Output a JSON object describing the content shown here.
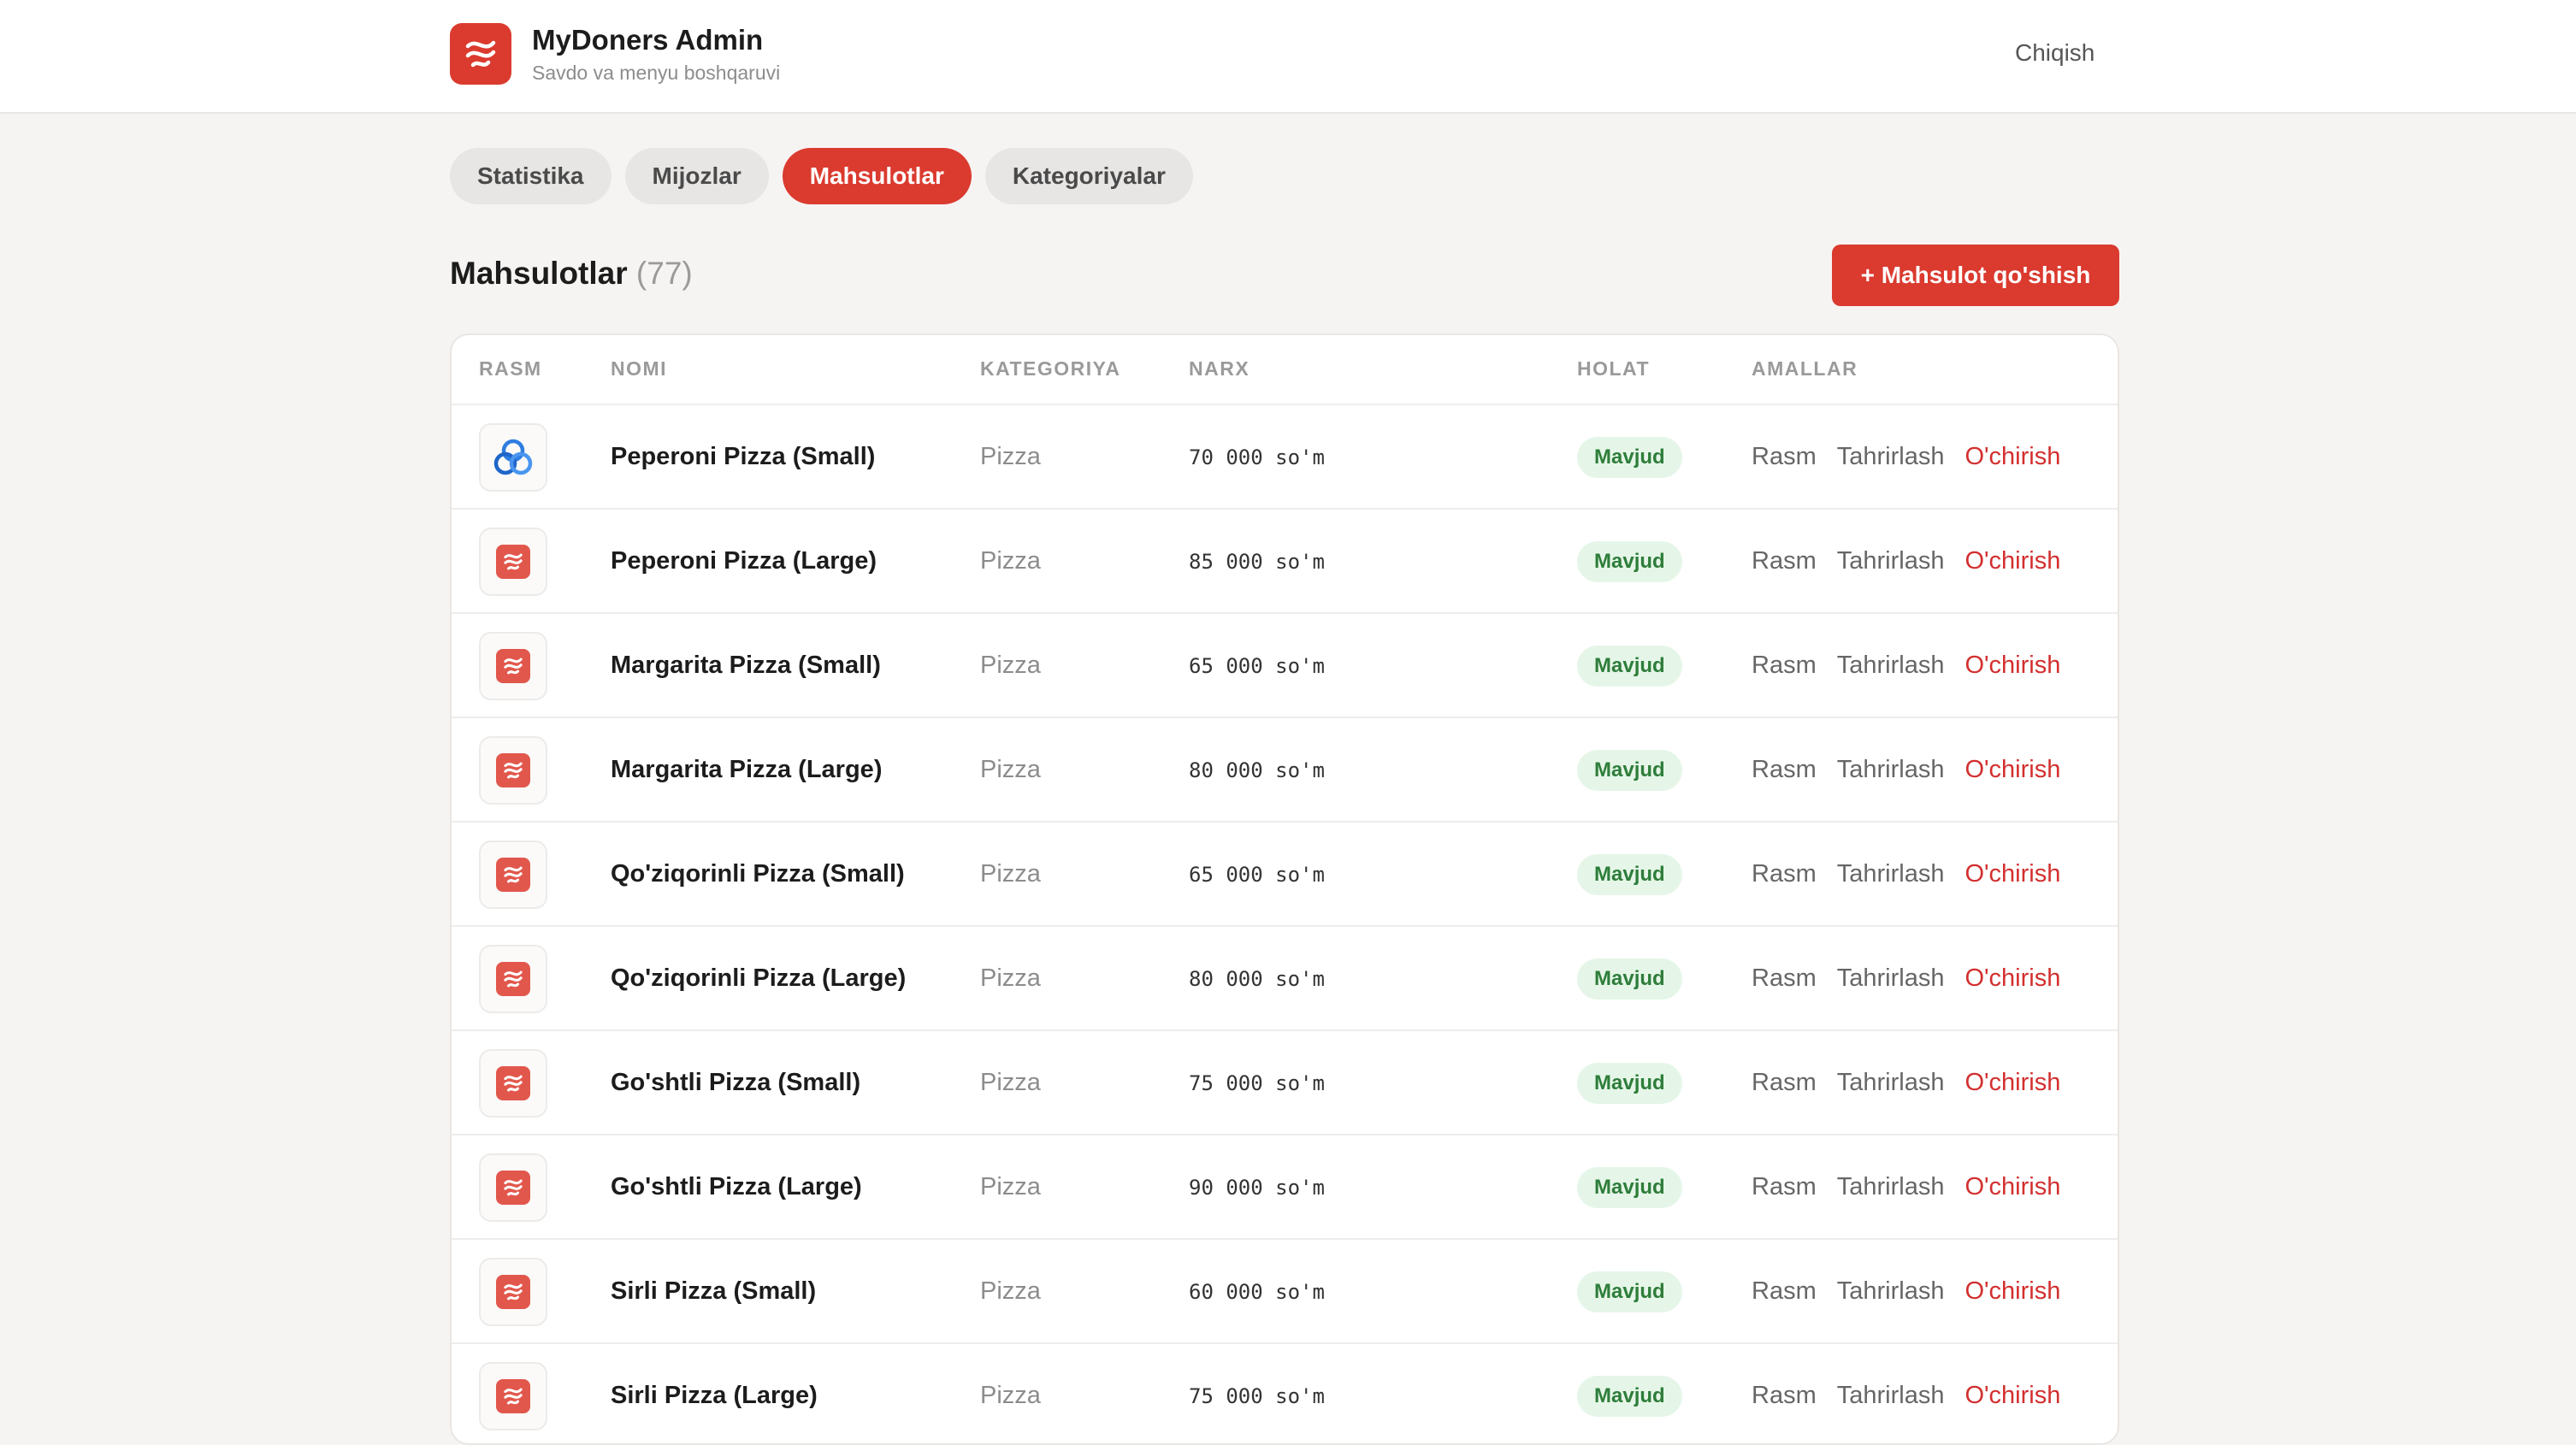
{
  "header": {
    "title": "MyDoners Admin",
    "subtitle": "Savdo va menyu boshqaruvi",
    "logout_label": "Chiqish"
  },
  "tabs": [
    {
      "label": "Statistika",
      "active": false
    },
    {
      "label": "Mijozlar",
      "active": false
    },
    {
      "label": "Mahsulotlar",
      "active": true
    },
    {
      "label": "Kategoriyalar",
      "active": false
    }
  ],
  "section": {
    "title": "Mahsulotlar",
    "count": "(77)",
    "add_button_label": "+ Mahsulot qo'shish"
  },
  "table": {
    "columns": [
      "RASM",
      "NOMI",
      "KATEGORIYA",
      "NARX",
      "HOLAT",
      "AMALLAR"
    ],
    "rows": [
      {
        "image": "three-rings-icon",
        "name": "Peperoni Pizza (Small)",
        "category": "Pizza",
        "price": "70 000 so'm",
        "status": "Mavjud",
        "actions": [
          "Rasm",
          "Tahrirlash",
          "O'chirish"
        ]
      },
      {
        "image": "brand-logo-icon",
        "name": "Peperoni Pizza (Large)",
        "category": "Pizza",
        "price": "85 000 so'm",
        "status": "Mavjud",
        "actions": [
          "Rasm",
          "Tahrirlash",
          "O'chirish"
        ]
      },
      {
        "image": "brand-logo-icon",
        "name": "Margarita Pizza (Small)",
        "category": "Pizza",
        "price": "65 000 so'm",
        "status": "Mavjud",
        "actions": [
          "Rasm",
          "Tahrirlash",
          "O'chirish"
        ]
      },
      {
        "image": "brand-logo-icon",
        "name": "Margarita Pizza (Large)",
        "category": "Pizza",
        "price": "80 000 so'm",
        "status": "Mavjud",
        "actions": [
          "Rasm",
          "Tahrirlash",
          "O'chirish"
        ]
      },
      {
        "image": "brand-logo-icon",
        "name": "Qo'ziqorinli Pizza (Small)",
        "category": "Pizza",
        "price": "65 000 so'm",
        "status": "Mavjud",
        "actions": [
          "Rasm",
          "Tahrirlash",
          "O'chirish"
        ]
      },
      {
        "image": "brand-logo-icon",
        "name": "Qo'ziqorinli Pizza (Large)",
        "category": "Pizza",
        "price": "80 000 so'm",
        "status": "Mavjud",
        "actions": [
          "Rasm",
          "Tahrirlash",
          "O'chirish"
        ]
      },
      {
        "image": "brand-logo-icon",
        "name": "Go'shtli Pizza (Small)",
        "category": "Pizza",
        "price": "75 000 so'm",
        "status": "Mavjud",
        "actions": [
          "Rasm",
          "Tahrirlash",
          "O'chirish"
        ]
      },
      {
        "image": "brand-logo-icon",
        "name": "Go'shtli Pizza (Large)",
        "category": "Pizza",
        "price": "90 000 so'm",
        "status": "Mavjud",
        "actions": [
          "Rasm",
          "Tahrirlash",
          "O'chirish"
        ]
      },
      {
        "image": "brand-logo-icon",
        "name": "Sirli Pizza (Small)",
        "category": "Pizza",
        "price": "60 000 so'm",
        "status": "Mavjud",
        "actions": [
          "Rasm",
          "Tahrirlash",
          "O'chirish"
        ]
      },
      {
        "image": "brand-logo-icon",
        "name": "Sirli Pizza (Large)",
        "category": "Pizza",
        "price": "75 000 so'm",
        "status": "Mavjud",
        "actions": [
          "Rasm",
          "Tahrirlash",
          "O'chirish"
        ]
      }
    ]
  },
  "colors": {
    "accent": "#db3a2f",
    "danger_text": "#d32f2f",
    "status_bg": "#e5f6e8",
    "status_text": "#2e7d3a",
    "page_bg": "#f6f4f2"
  }
}
